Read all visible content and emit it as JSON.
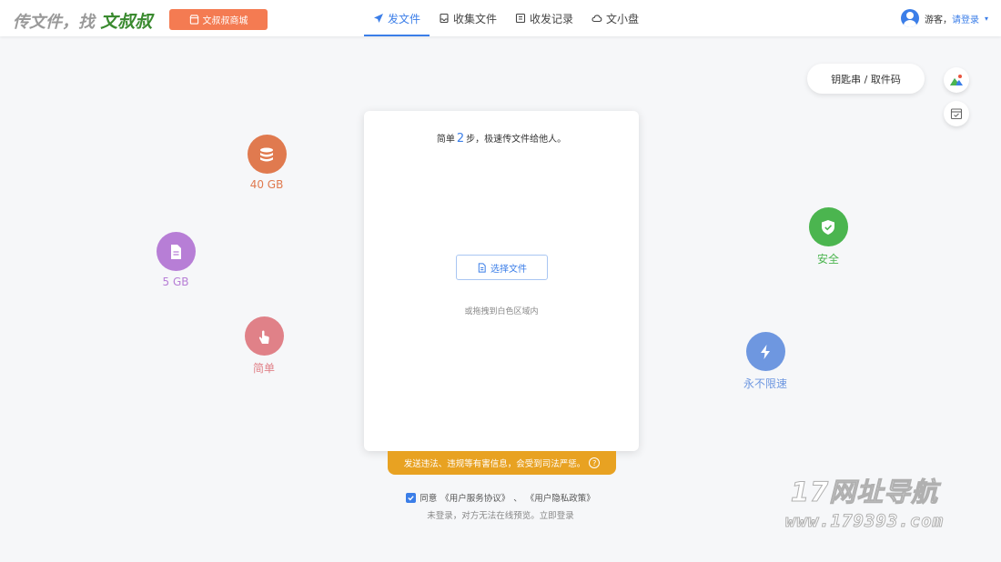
{
  "header": {
    "logo_prefix": "传文件，找",
    "logo_brand": "文叔叔",
    "shop_label": "文叔叔商城",
    "nav": [
      {
        "label": "发文件",
        "icon": "send-icon",
        "active": true
      },
      {
        "label": "收集文件",
        "icon": "collect-icon",
        "active": false
      },
      {
        "label": "收发记录",
        "icon": "record-icon",
        "active": false
      },
      {
        "label": "文小盘",
        "icon": "cloud-icon",
        "active": false
      }
    ],
    "user_label": "游客，",
    "login_label": "请登录",
    "caret": "▾"
  },
  "widgets": {
    "key_label": "钥匙串 / 取件码"
  },
  "features": [
    {
      "label": "40 GB",
      "color": "#e07a4f",
      "icon": "database-icon"
    },
    {
      "label": "5 GB",
      "color": "#b77ed6",
      "icon": "file-icon"
    },
    {
      "label": "简单",
      "color": "#e08188",
      "icon": "tap-icon"
    },
    {
      "label": "安全",
      "color": "#4bb54f",
      "icon": "shield-icon"
    },
    {
      "label": "永不限速",
      "color": "#6e97e0",
      "icon": "lightning-icon"
    }
  ],
  "card": {
    "tip_before": "简单",
    "tip_num": "2",
    "tip_after": "步，极速传文件给他人。",
    "select_label": "选择文件",
    "drag_tip": "或拖拽到白色区域内"
  },
  "warning": {
    "text": "发送违法、违规等有害信息，会受到司法严惩。",
    "help": "?"
  },
  "agreement": {
    "prefix": "同意",
    "terms": "《用户服务协议》",
    "sep": "、",
    "privacy": "《用户隐私政策》",
    "note": "未登录，对方无法在线预览。立即登录"
  },
  "watermark": {
    "line1": "17网址导航",
    "line2": "www.179393.com"
  }
}
